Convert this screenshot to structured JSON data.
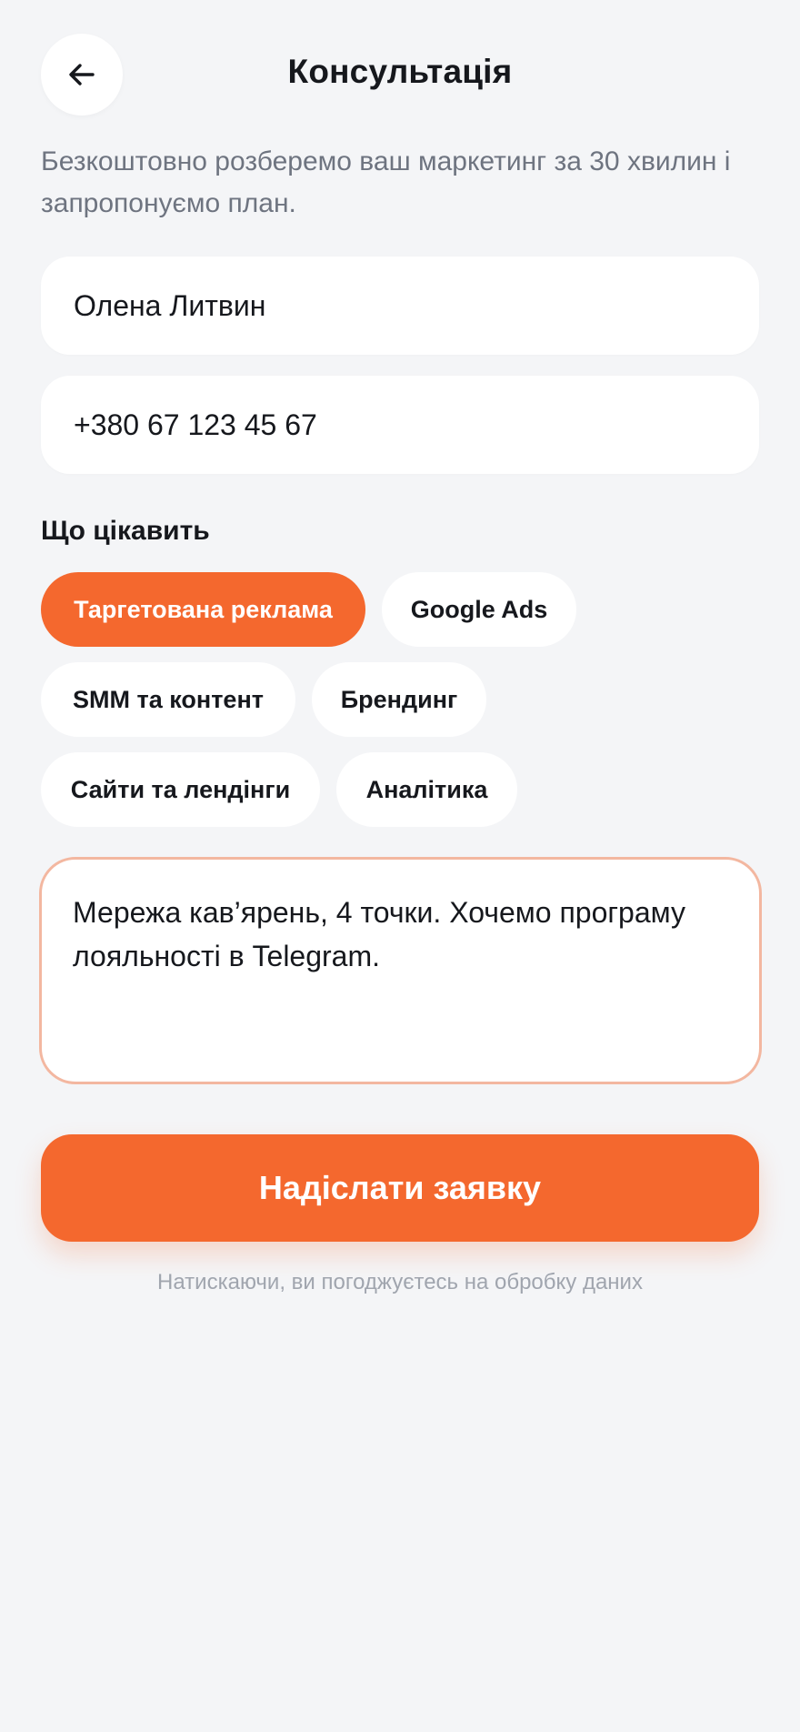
{
  "header": {
    "title": "Консультація",
    "back_icon": "arrow-left-icon"
  },
  "intro": {
    "text": "Безкоштовно розберемо ваш маркетинг за 30 хвилин і запропонуємо план."
  },
  "form": {
    "name_value": "Олена Литвин",
    "phone_value": "+380 67 123 45 67",
    "interests_label": "Що цікавить",
    "interests": [
      {
        "label": "Таргетована реклама",
        "selected": true
      },
      {
        "label": "Google Ads",
        "selected": false
      },
      {
        "label": "SMM та контент",
        "selected": false
      },
      {
        "label": "Брендинг",
        "selected": false
      },
      {
        "label": "Сайти та лендінги",
        "selected": false
      },
      {
        "label": "Аналітика",
        "selected": false
      }
    ],
    "message_value": "Мережа кав’ярень, 4 точки. Хочемо програму лояльності в Telegram.",
    "submit_label": "Надіслати заявку",
    "consent_text": "Натискаючи, ви погоджуєтесь на обробку даних"
  },
  "colors": {
    "accent": "#f4682e",
    "background": "#f4f5f7",
    "text_primary": "#16181d",
    "text_secondary": "#6e7480",
    "text_muted": "#a0a5ae",
    "focus_border": "#f3b7a0"
  }
}
